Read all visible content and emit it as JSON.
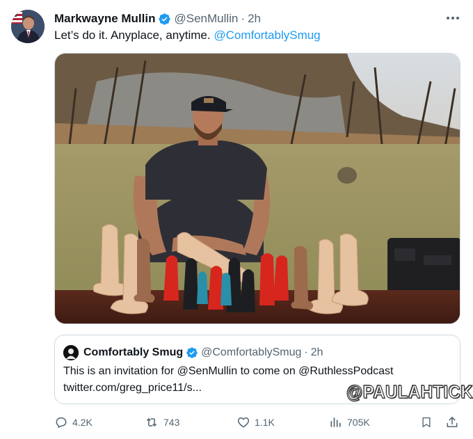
{
  "tweet": {
    "author_name": "Markwayne Mullin",
    "handle": "@SenMullin",
    "separator": "·",
    "time": "2h",
    "text_prefix": "Let’s do it. Anyplace, anytime. ",
    "text_mention": "@ComfortablySmug"
  },
  "quoted_tweet": {
    "author_name": "Comfortably Smug",
    "handle": "@ComfortablySmug",
    "separator": "·",
    "time": "2h",
    "line1": "This is an invitation for @SenMullin to come on @RuthlessPodcast",
    "line2": "twitter.com/greg_price11/s..."
  },
  "watermark": "@PAULAHTICKS",
  "actions": {
    "replies": "4.2K",
    "retweets": "743",
    "likes": "1.1K",
    "views": "705K"
  },
  "icons": {
    "verified": "verified-badge-icon",
    "more": "more-icon",
    "reply": "reply-icon",
    "retweet": "retweet-icon",
    "like": "heart-icon",
    "views": "views-chart-icon",
    "bookmark": "bookmark-icon",
    "share": "share-icon"
  },
  "colors": {
    "accent": "#1d9bf0",
    "secondary_text": "#536471",
    "border": "#cfd9de"
  }
}
